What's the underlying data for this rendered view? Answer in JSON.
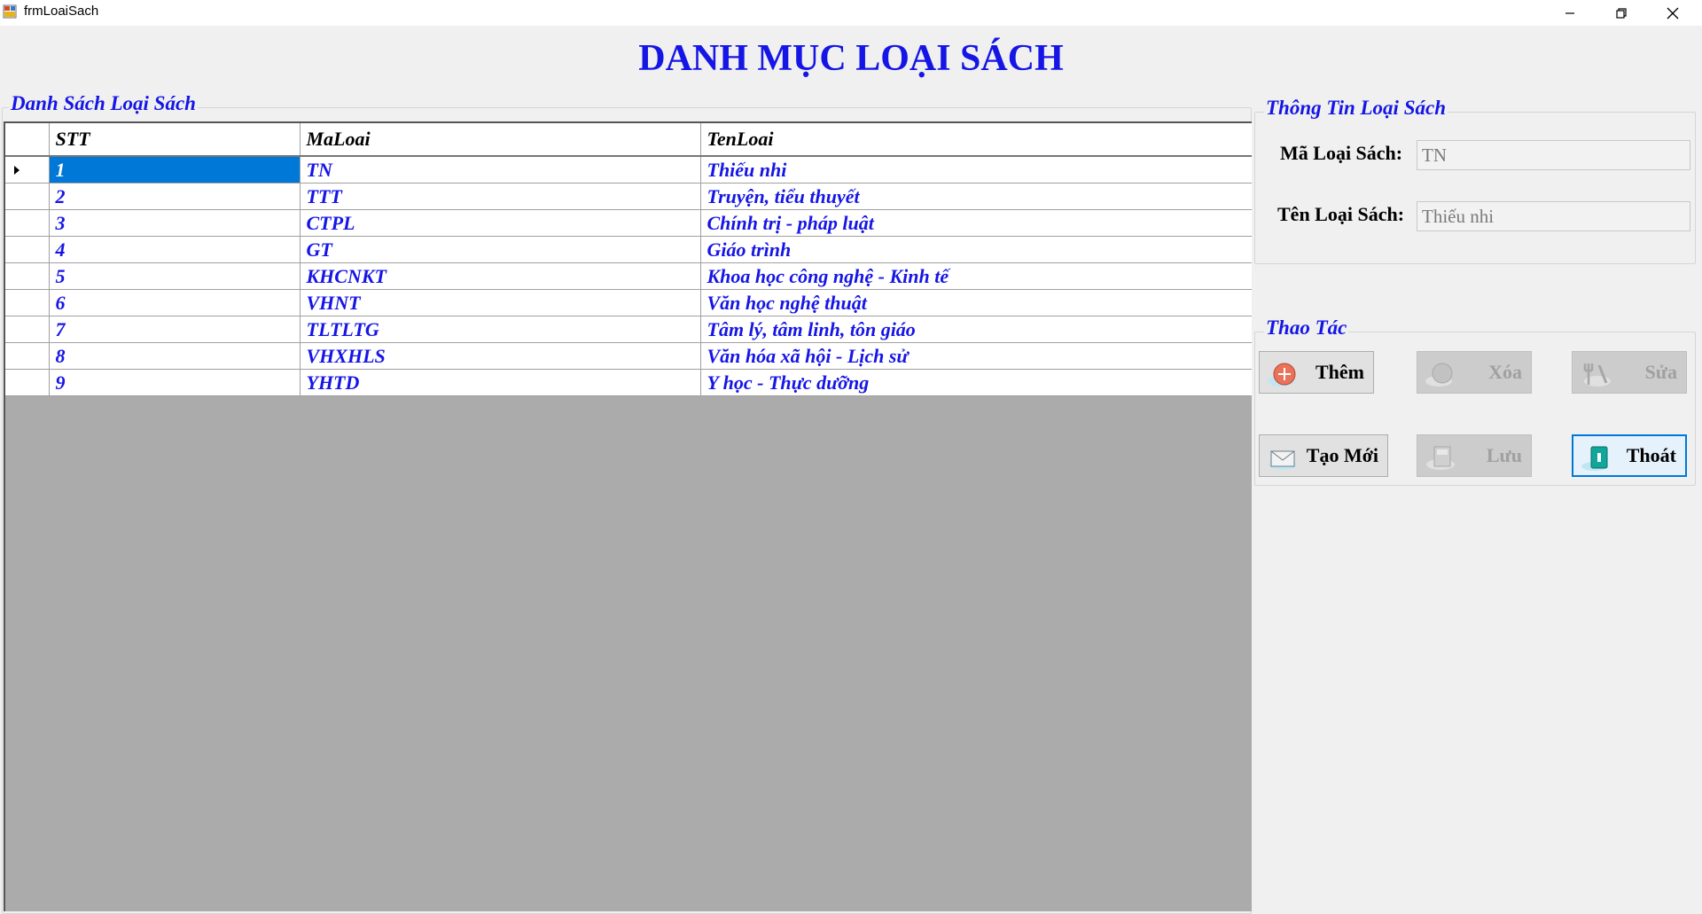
{
  "window": {
    "title": "frmLoaiSach"
  },
  "heading": "DANH MỤC LOẠI SÁCH",
  "list_group": {
    "title": "Danh Sách Loại Sách"
  },
  "grid": {
    "columns": [
      "STT",
      "MaLoai",
      "TenLoai"
    ],
    "rows": [
      {
        "stt": "1",
        "ma": "TN",
        "ten": "Thiếu nhi"
      },
      {
        "stt": "2",
        "ma": "TTT",
        "ten": "Truyện, tiểu thuyết"
      },
      {
        "stt": "3",
        "ma": "CTPL",
        "ten": "Chính trị - pháp luật"
      },
      {
        "stt": "4",
        "ma": "GT",
        "ten": "Giáo trình"
      },
      {
        "stt": "5",
        "ma": "KHCNKT",
        "ten": "Khoa học công nghệ - Kinh tế"
      },
      {
        "stt": "6",
        "ma": "VHNT",
        "ten": "Văn học nghệ thuật"
      },
      {
        "stt": "7",
        "ma": "TLTLTG",
        "ten": "Tâm lý, tâm linh, tôn giáo"
      },
      {
        "stt": "8",
        "ma": "VHXHLS",
        "ten": "Văn hóa xã hội - Lịch sử"
      },
      {
        "stt": "9",
        "ma": "YHTD",
        "ten": "Y học - Thực dưỡng"
      }
    ]
  },
  "info_group": {
    "title": "Thông Tin Loại Sách",
    "ma_label": "Mã Loại Sách:",
    "ma_value": "TN",
    "ten_label": "Tên Loại Sách:",
    "ten_value": "Thiếu nhi"
  },
  "actions_group": {
    "title": "Thao Tác",
    "them": "Thêm",
    "xoa": "Xóa",
    "sua": "Sửa",
    "tao_moi": "Tạo Mới",
    "luu": "Lưu",
    "thoat": "Thoát"
  },
  "colors": {
    "accent": "#1515e6",
    "selection": "#0078d7",
    "grid_bg": "#ababab"
  }
}
